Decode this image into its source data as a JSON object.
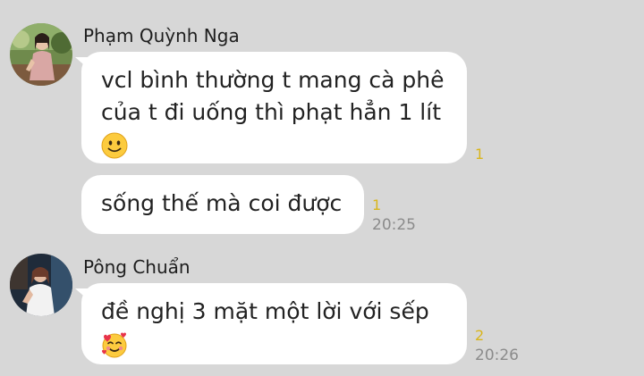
{
  "messages": [
    {
      "sender": "Phạm Quỳnh Nga",
      "bubbles": [
        {
          "lines": [
            "vcl bình thường t mang cà phê",
            "của t đi uống thì phạt hẳn 1 lít"
          ],
          "emoji": "slightly-smiling-face-emoji",
          "reactions": "1"
        },
        {
          "lines": [
            "sống thế mà coi được"
          ],
          "reactions": "1",
          "time": "20:25"
        }
      ]
    },
    {
      "sender": "Pông Chuẩn",
      "bubbles": [
        {
          "lines": [
            "đề nghị 3 mặt một lời với sếp"
          ],
          "emoji": "smiling-face-with-hearts-emoji",
          "reactions": "2",
          "time": "20:26"
        }
      ]
    }
  ],
  "colors": {
    "background": "#d7d7d7",
    "bubble": "#ffffff",
    "reaction_count": "#d9b51b",
    "timestamp": "#8b8b8b"
  }
}
